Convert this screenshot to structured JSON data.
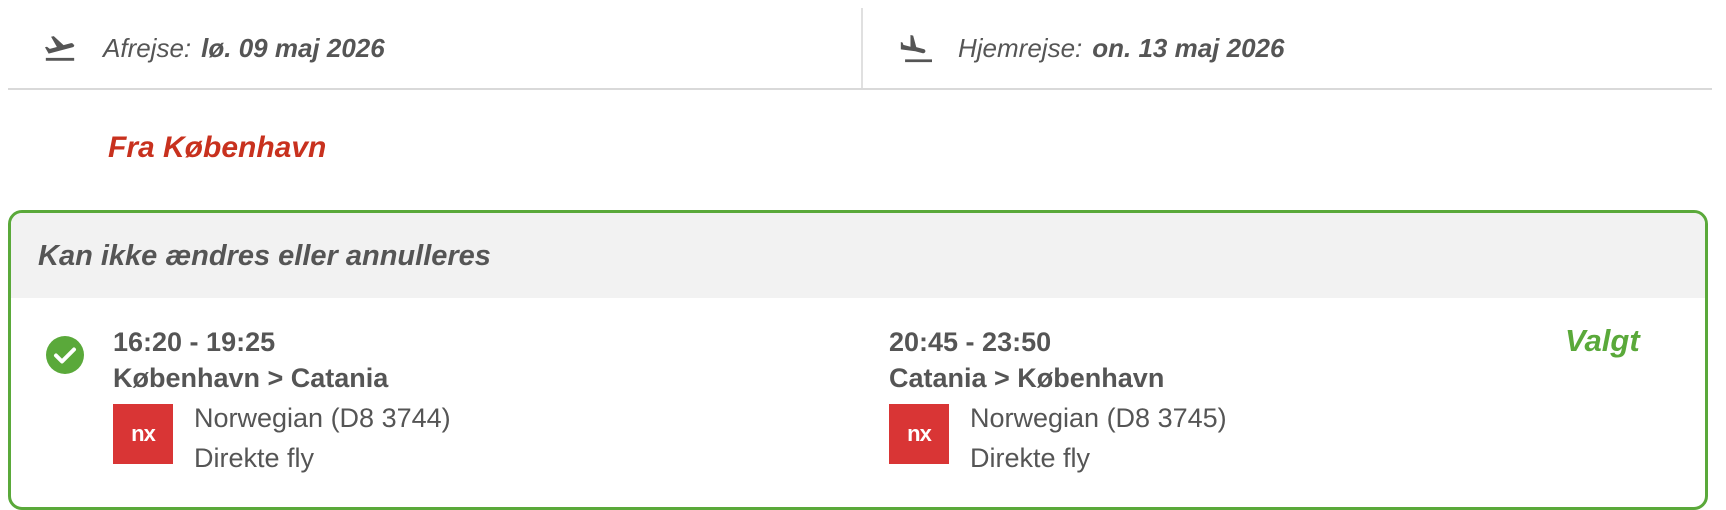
{
  "dates": {
    "outbound": {
      "label": "Afrejse:",
      "value": "lø. 09 maj 2026",
      "icon": "plane-departure-icon"
    },
    "return": {
      "label": "Hjemrejse:",
      "value": "on. 13 maj 2026",
      "icon": "plane-arrival-icon"
    }
  },
  "section_title": "Fra København",
  "card": {
    "header": "Kan ikke ændres eller annulleres",
    "status": "Valgt",
    "check_icon": "check-circle-icon",
    "outbound": {
      "time": "16:20 - 19:25",
      "route": "København > Catania",
      "carrier": "Norwegian (D8 3744)",
      "type": "Direkte fly",
      "logo_text": "nx"
    },
    "return": {
      "time": "20:45 - 23:50",
      "route": "Catania > København",
      "carrier": "Norwegian (D8 3745)",
      "type": "Direkte fly",
      "logo_text": "nx"
    }
  },
  "colors": {
    "accent_red": "#c8311e",
    "selected_green": "#5aa93a",
    "logo_red": "#d93535"
  }
}
